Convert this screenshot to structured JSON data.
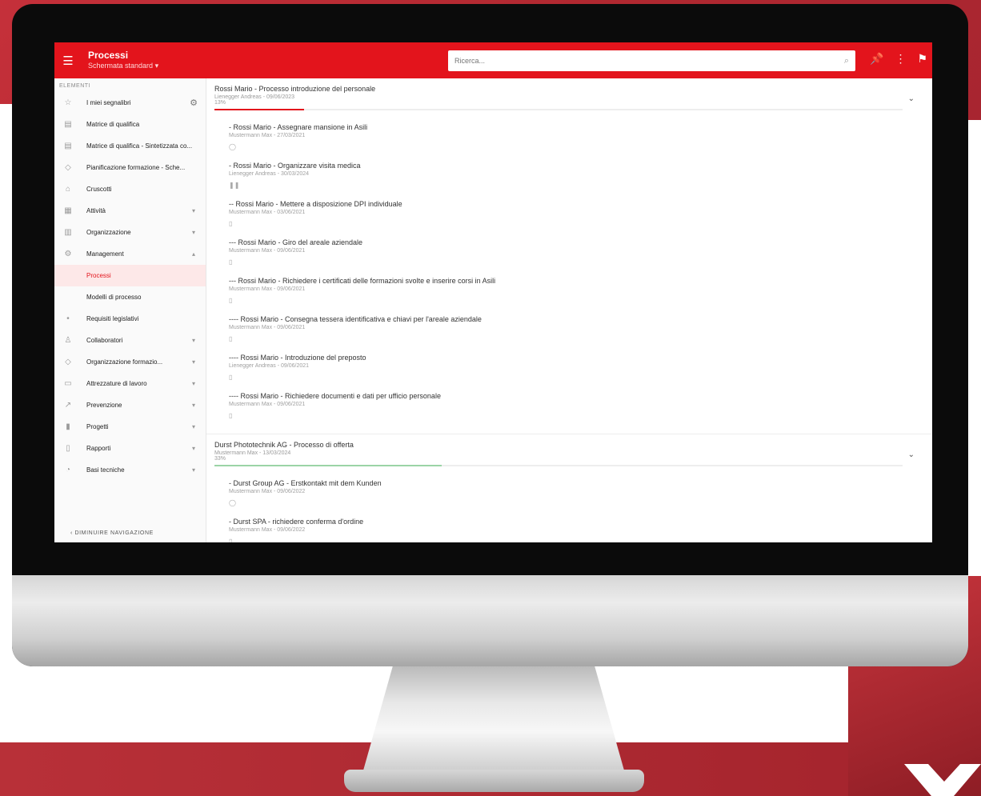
{
  "topbar": {
    "menu_icon": "hamburger-icon",
    "title": "Processi",
    "view_label": "Schermata standard",
    "search_placeholder": "Ricerca...",
    "icons": [
      "search-icon",
      "pin-icon",
      "more-vert-icon",
      "user-icon"
    ]
  },
  "sidebar": {
    "section_label": "ELEMENTI",
    "items": [
      {
        "label": "I miei segnalibri",
        "icon": "star-icon",
        "has_settings": true
      },
      {
        "label": "Matrice di qualifica",
        "icon": "grid-icon"
      },
      {
        "label": "Matrice di qualifica - Sintetizzata co...",
        "icon": "grid-icon"
      },
      {
        "label": "Pianificazione formazione - Sche...",
        "icon": "education-icon"
      },
      {
        "label": "Cruscotti",
        "icon": "home-icon"
      },
      {
        "label": "Attività",
        "icon": "calendar-icon",
        "chevron": "down"
      },
      {
        "label": "Organizzazione",
        "icon": "org-icon",
        "chevron": "down"
      },
      {
        "label": "Management",
        "icon": "gear-icon",
        "chevron": "up"
      },
      {
        "label": "Processi",
        "icon": "",
        "sub": true,
        "active": true
      },
      {
        "label": "Modelli di processo",
        "icon": "",
        "sub": true
      },
      {
        "label": "Requisiti legislativi",
        "icon": "dot-icon"
      },
      {
        "label": "Collaboratori",
        "icon": "people-icon",
        "chevron": "down"
      },
      {
        "label": "Organizzazione formazio...",
        "icon": "education-icon",
        "chevron": "down"
      },
      {
        "label": "Attrezzature di lavoro",
        "icon": "monitor-icon",
        "chevron": "down"
      },
      {
        "label": "Prevenzione",
        "icon": "trend-icon",
        "chevron": "down"
      },
      {
        "label": "Progetti",
        "icon": "chart-icon",
        "chevron": "down"
      },
      {
        "label": "Rapporti",
        "icon": "report-icon",
        "chevron": "down"
      },
      {
        "label": "Basi tecniche",
        "icon": "data-icon",
        "chevron": "down"
      }
    ],
    "collapse_label": "DIMINUIRE NAVIGAZIONE"
  },
  "processes": [
    {
      "title": "Rossi Mario - Processo introduzione del personale",
      "meta": "Lienegger Andreas - 09/06/2023",
      "percent_label": "13%",
      "progress": 0.13,
      "progress_color": "#e3141c",
      "tasks": [
        {
          "title": "- Rossi Mario - Assegnare mansione in Asili",
          "meta": "Mustermann Max - 27/03/2021",
          "icon": "check-circle-icon"
        },
        {
          "title": "- Rossi Mario - Organizzare visita medica",
          "meta": "Lienegger Andreas - 30/03/2024",
          "icon": "pause-icon"
        },
        {
          "title": "-- Rossi Mario - Mettere a disposizione DPI individuale",
          "meta": "Mustermann Max - 03/06/2021",
          "icon": "doc-icon"
        },
        {
          "title": "--- Rossi Mario - Giro del areale aziendale",
          "meta": "Mustermann Max - 09/06/2021",
          "icon": "doc-icon"
        },
        {
          "title": "--- Rossi Mario - Richiedere i certificati delle formazioni svolte e inserire corsi in Asili",
          "meta": "Mustermann Max - 09/06/2021",
          "icon": "doc-icon"
        },
        {
          "title": "---- Rossi Mario - Consegna tessera identificativa e chiavi per l'areale aziendale",
          "meta": "Mustermann Max - 09/06/2021",
          "icon": "doc-icon"
        },
        {
          "title": "---- Rossi Mario - Introduzione del preposto",
          "meta": "Lienegger Andreas - 09/06/2021",
          "icon": "doc-icon"
        },
        {
          "title": "---- Rossi Mario - Richiedere documenti e dati per ufficio personale",
          "meta": "Mustermann Max - 09/06/2021",
          "icon": "doc-icon"
        }
      ]
    },
    {
      "title": "Durst Phototechnik AG - Processo di offerta",
      "meta": "Mustermann Max - 13/03/2024",
      "percent_label": "33%",
      "progress": 0.33,
      "progress_color": "#9bd4a6",
      "tasks": [
        {
          "title": "- Durst Group AG - Erstkontakt mit dem Kunden",
          "meta": "Mustermann Max - 09/06/2022",
          "icon": "check-circle-icon"
        },
        {
          "title": "- Durst SPA - richiedere conferma d'ordine",
          "meta": "Mustermann Max - 09/06/2022",
          "icon": "doc-icon"
        }
      ]
    }
  ]
}
